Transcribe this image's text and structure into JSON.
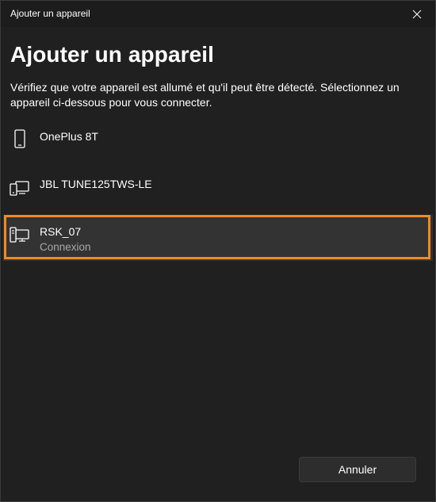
{
  "window": {
    "title": "Ajouter un appareil"
  },
  "dialog": {
    "heading": "Ajouter un appareil",
    "instructions": "Vérifiez que votre appareil est allumé et qu'il peut être détecté. Sélectionnez un appareil ci-dessous pour vous connecter."
  },
  "devices": [
    {
      "name": "OnePlus 8T",
      "status": "",
      "icon": "phone-icon"
    },
    {
      "name": "JBL TUNE125TWS-LE",
      "status": "",
      "icon": "devices-icon"
    },
    {
      "name": "RSK_07",
      "status": "Connexion",
      "icon": "computer-devices-icon"
    }
  ],
  "footer": {
    "cancel_label": "Annuler"
  },
  "colors": {
    "background": "#202020",
    "highlight": "#f08a24",
    "selected_row": "#333333",
    "secondary_text": "#a8a8a8"
  }
}
